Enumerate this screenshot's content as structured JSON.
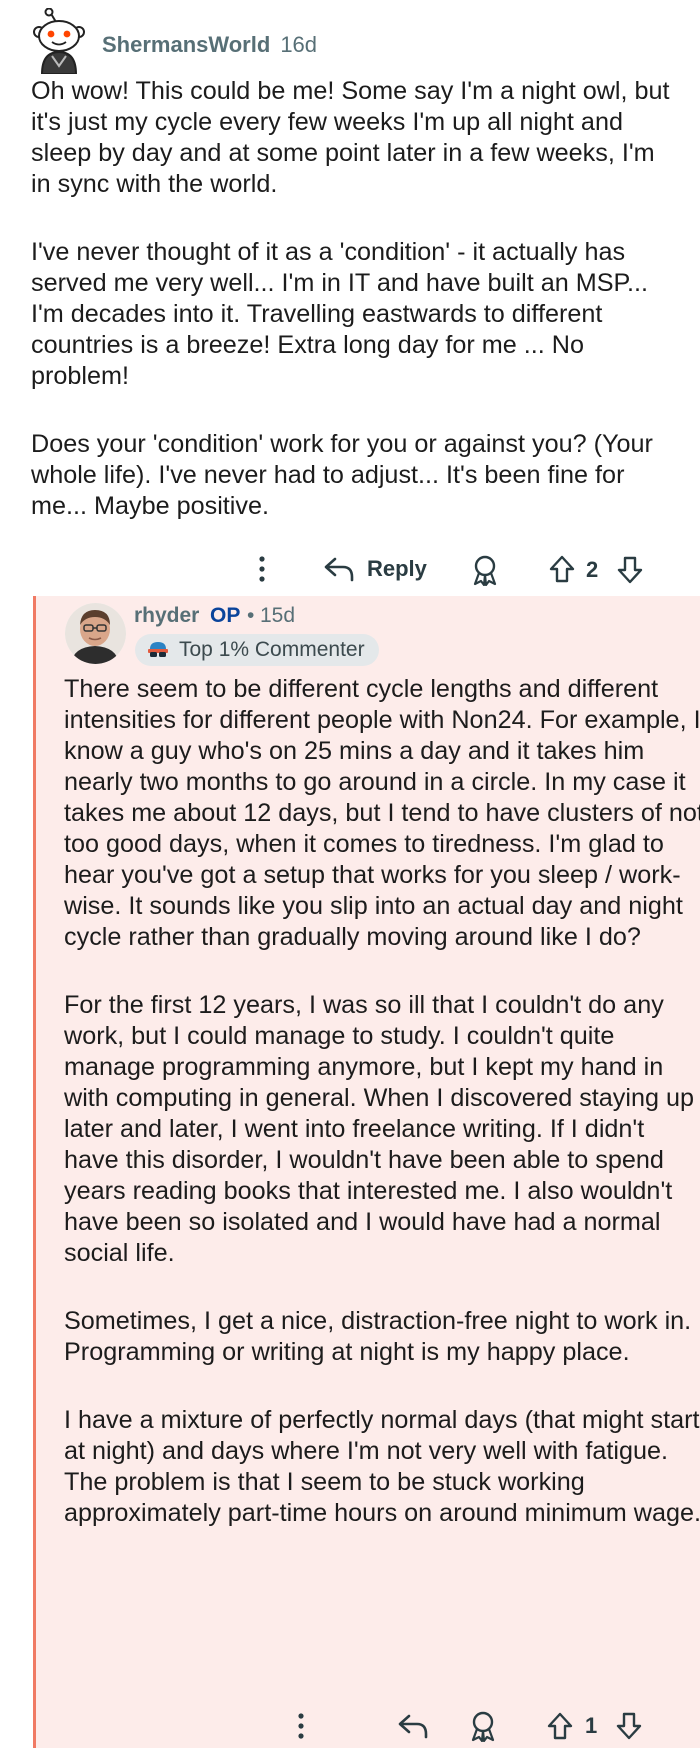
{
  "comment": {
    "username": "ShermansWorld",
    "age": "16d",
    "paragraphs": [
      "Oh wow! This could be me! Some say I'm a night owl, but it's just my cycle every few weeks I'm up all night and sleep by day and at some point later in a few weeks, I'm in sync with the world.",
      "I've never thought of it as a 'condition' - it actually has served me very well... I'm in IT and have built an MSP... I'm decades into it. Travelling eastwards to different countries is a breeze! Extra long day for me ... No problem!",
      "Does your 'condition' work for you or against you? (Your whole life). I've never had to adjust... It's been fine for me... Maybe positive."
    ],
    "actions": {
      "more_icon": "more-vertical-icon",
      "reply_icon": "reply-arrow-icon",
      "reply_label": "Reply",
      "award_icon": "award-icon",
      "upvote_icon": "upvote-arrow-icon",
      "vote_count": "2",
      "downvote_icon": "downvote-arrow-icon"
    }
  },
  "reply": {
    "username": "rhyder",
    "op_badge": "OP",
    "separator": "•",
    "age": "15d",
    "flair": {
      "icon": "sunglasses-icon",
      "label": "Top 1% Commenter"
    },
    "paragraphs": [
      "There seem to be different cycle lengths and different intensities for different people with Non24. For example, I know a guy who's on 25 mins a day and it takes him nearly two months to go around in a circle. In my case it takes me about 12 days, but I tend to have clusters of not too good days, when it comes to tiredness. I'm glad to hear you've got a setup that works for you sleep / work-wise. It sounds like you slip into an actual day and night cycle rather than gradually moving around like I do?",
      "For the first 12 years, I was so ill that I couldn't do any work, but I could manage to study. I couldn't quite manage programming anymore, but I kept my hand in with computing in general. When I discovered staying up later and later, I went into freelance writing. If I didn't have this disorder, I wouldn't have been able to spend years reading books that interested me. I also wouldn't have been so isolated and I would have had a normal social life.",
      "Sometimes, I get a nice, distraction-free night to work in. Programming or writing at night is my happy place.",
      "I have a mixture of perfectly normal days (that might start at night) and days where I'm not very well with fatigue. The problem is that I seem to be stuck working approximately part-time hours on around minimum wage."
    ],
    "actions": {
      "more_icon": "more-vertical-icon",
      "reply_icon": "reply-arrow-icon",
      "award_icon": "award-icon",
      "upvote_icon": "upvote-arrow-icon",
      "vote_count": "1",
      "downvote_icon": "downvote-arrow-icon"
    }
  },
  "colors": {
    "thread_line": "#f07a64",
    "reply_background": "#fdecea",
    "op_badge": "#0a449b",
    "meta_text": "#576f76"
  }
}
